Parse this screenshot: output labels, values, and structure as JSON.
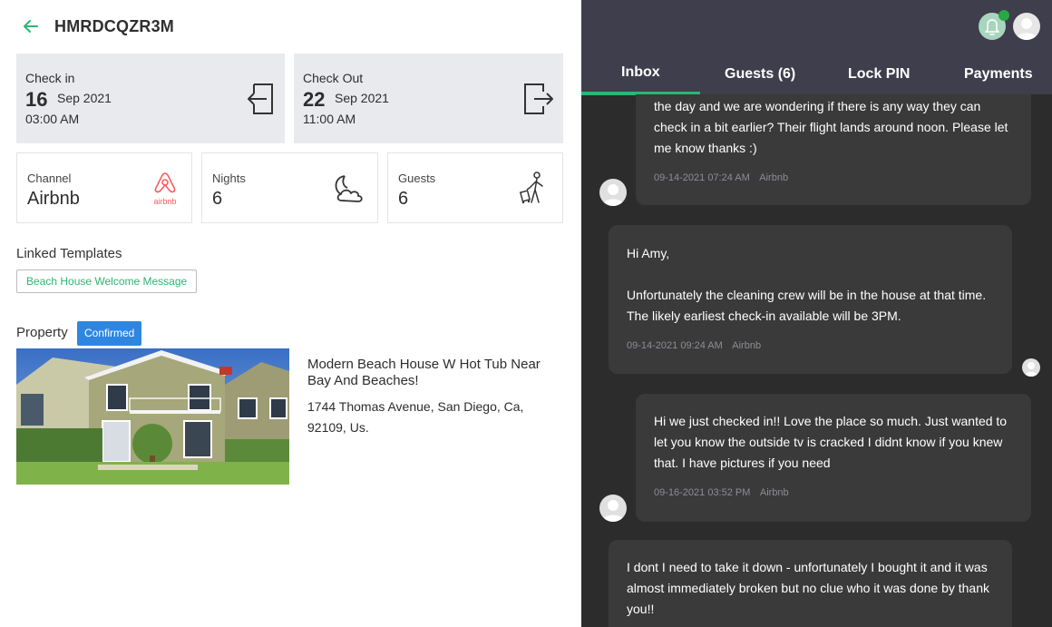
{
  "reservation": {
    "code": "HMRDCQZR3M"
  },
  "check_in": {
    "label": "Check in",
    "day": "16",
    "month_year": "Sep 2021",
    "time": "03:00 AM"
  },
  "check_out": {
    "label": "Check Out",
    "day": "22",
    "month_year": "Sep 2021",
    "time": "11:00 AM"
  },
  "stats": {
    "channel": {
      "label": "Channel",
      "value": "Airbnb",
      "icon": "airbnb-logo",
      "logo_text": "airbnb"
    },
    "nights": {
      "label": "Nights",
      "value": "6",
      "icon": "moon-cloud-icon"
    },
    "guests": {
      "label": "Guests",
      "value": "6",
      "icon": "traveler-icon"
    }
  },
  "linked_templates": {
    "title": "Linked Templates",
    "items": [
      "Beach House Welcome Message"
    ]
  },
  "property": {
    "title": "Property",
    "status": "Confirmed",
    "name": "Modern Beach House W Hot Tub Near Bay And Beaches!",
    "address": "1744 Thomas Avenue, San Diego, Ca, 92109, Us."
  },
  "tabs": [
    "Inbox",
    "Guests (6)",
    "Lock PIN",
    "Payments"
  ],
  "messages": [
    {
      "text": "the day and we are wondering if there is any way they can check in a bit earlier? Their flight lands around noon. Please let me know thanks :)",
      "timestamp": "09-14-2021 07:24 AM",
      "channel": "Airbnb",
      "side": "guest"
    },
    {
      "text_lines": [
        "Hi Amy,",
        "",
        "Unfortunately the cleaning crew will be in the house at that time. The likely earliest check-in available will be 3PM."
      ],
      "timestamp": "09-14-2021 09:24 AM",
      "channel": "Airbnb",
      "side": "host"
    },
    {
      "text": "Hi we just checked in!! Love the place so much. Just wanted to let you know the outside tv is cracked I didnt know if you knew that. I have pictures if you need",
      "timestamp": "09-16-2021 03:52 PM",
      "channel": "Airbnb",
      "side": "guest"
    },
    {
      "text": "I dont I need to take it down - unfortunately I bought it and it was almost immediately broken but no clue who it was done by thank you!!",
      "side": "host"
    }
  ],
  "colors": {
    "accent_green": "#2bb673",
    "badge_blue": "#2f86e0",
    "airbnb_red": "#ff5a5f",
    "dark_bg": "#2c2c2c",
    "header_bg": "#3e3e4c"
  }
}
